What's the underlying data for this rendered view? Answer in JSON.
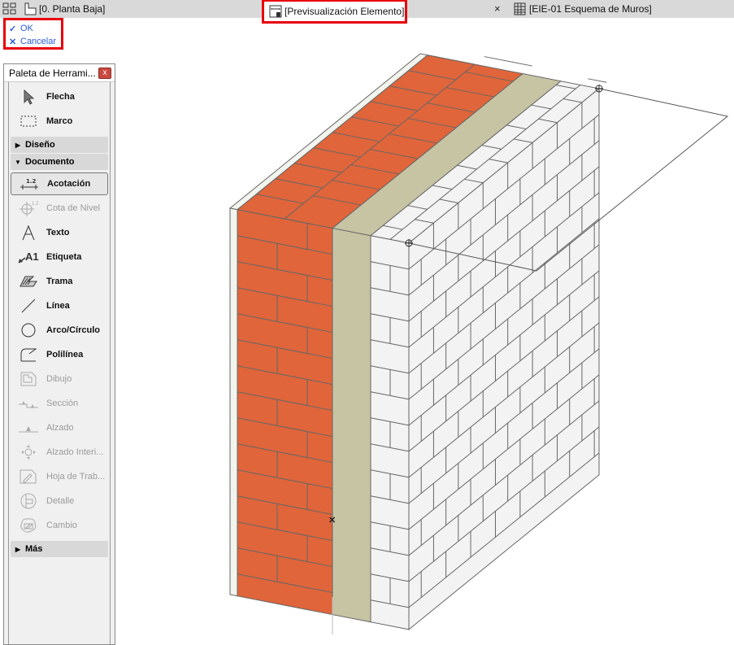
{
  "tabs": [
    {
      "label": "[0. Planta Baja]",
      "icon": "floor-plan-icon"
    },
    {
      "label": "[Previsualización Elemento]",
      "icon": "element-preview-icon",
      "active": true
    },
    {
      "label": "[EIE-01 Esquema de Muros]",
      "icon": "schedule-grid-icon"
    }
  ],
  "close_tab": "×",
  "actions": {
    "ok": "OK",
    "cancel": "Cancelar"
  },
  "palette": {
    "title": "Paleta de Herrami...",
    "items_top": [
      {
        "label": "Flecha"
      },
      {
        "label": "Marco"
      }
    ],
    "sections": {
      "design": "Diseño",
      "document": "Documento",
      "more": "Más"
    },
    "doc_items": [
      {
        "label": "Acotación",
        "enabled": true,
        "selected": true
      },
      {
        "label": "Cota de Nivel",
        "enabled": false
      },
      {
        "label": "Texto",
        "enabled": true
      },
      {
        "label": "Etiqueta",
        "enabled": true
      },
      {
        "label": "Trama",
        "enabled": true
      },
      {
        "label": "Línea",
        "enabled": true
      },
      {
        "label": "Arco/Círculo",
        "enabled": true
      },
      {
        "label": "Polilínea",
        "enabled": true
      },
      {
        "label": "Dibujo",
        "enabled": false
      },
      {
        "label": "Sección",
        "enabled": false
      },
      {
        "label": "Alzado",
        "enabled": false
      },
      {
        "label": "Alzado Interi...",
        "enabled": false
      },
      {
        "label": "Hoja de Trab...",
        "enabled": false
      },
      {
        "label": "Detalle",
        "enabled": false
      },
      {
        "label": "Cambio",
        "enabled": false
      }
    ],
    "icon_text": {
      "dim": "1.2",
      "label": "A1"
    }
  },
  "colors": {
    "brick": "#e0653a",
    "insulation": "#c7c4a4",
    "block": "#f3f3f3",
    "plaster": "#f2f4ee",
    "line": "#666666",
    "accent": "#e8000b",
    "link": "#2a5bd7"
  }
}
